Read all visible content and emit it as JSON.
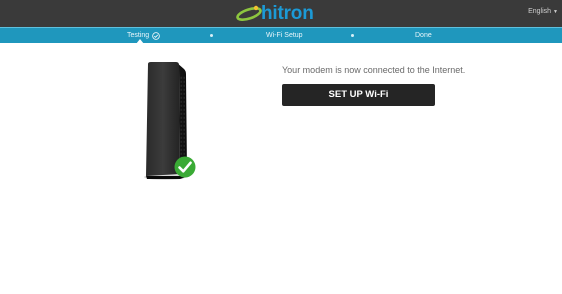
{
  "header": {
    "brand": "hitron",
    "language": "English",
    "icons": {
      "language_caret": "chevron-down-icon",
      "logo": "hitron-swoosh-logo"
    },
    "colors": {
      "brand_blue": "#1c9ad6",
      "brand_green": "#8dc63f",
      "bar": "#3a3a3a"
    }
  },
  "steps": {
    "items": [
      {
        "label": "Testing",
        "state": "active",
        "icon": "check-circle-icon"
      },
      {
        "label": "Wi-Fi Setup",
        "state": "pending"
      },
      {
        "label": "Done",
        "state": "pending"
      }
    ],
    "colors": {
      "bar": "#1f97bd"
    }
  },
  "main": {
    "message": "Your modem is now connected to the Internet.",
    "setup_button": "SET UP Wi-Fi",
    "modem_image": {
      "icon": "cable-modem-image",
      "status_icon": "green-check-icon",
      "status_color": "#3aaa35"
    }
  }
}
